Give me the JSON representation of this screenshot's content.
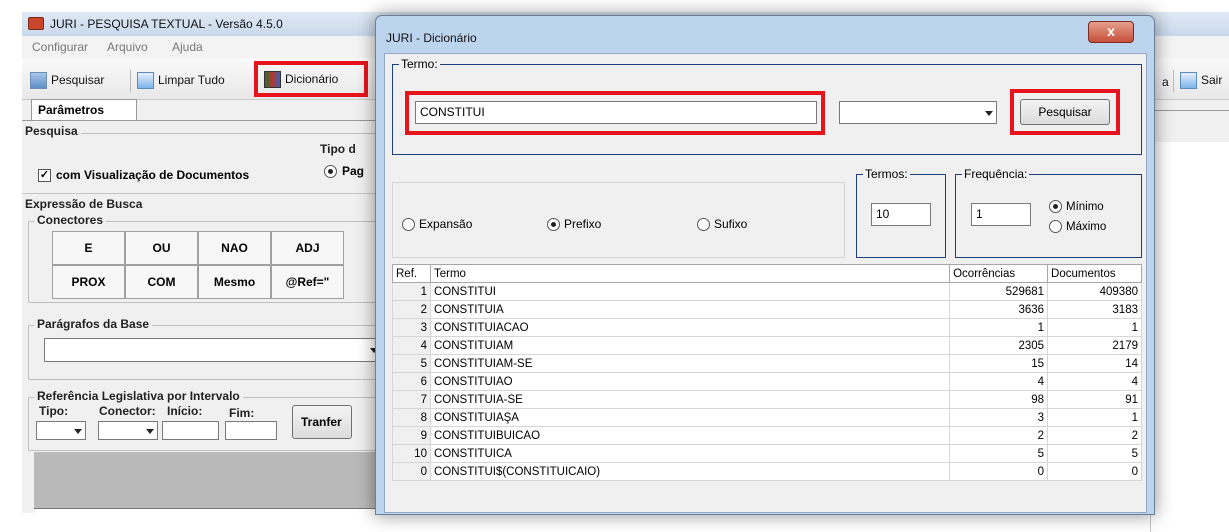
{
  "main_window": {
    "title": "JURI - PESQUISA TEXTUAL - Versão 4.5.0",
    "menu": [
      "Configurar",
      "Arquivo",
      "Ajuda"
    ],
    "toolbar": {
      "pesquisar": "Pesquisar",
      "limpar": "Limpar Tudo",
      "dicionario": "Dicionário",
      "partial_a": "a",
      "sair": "Sair"
    },
    "tab_label": "Parâmetros",
    "pesquisa": {
      "group_label": "Pesquisa",
      "checkbox_label": "com Visualização de Documentos",
      "tipo_label": "Tipo d",
      "tipo_option": "Pag"
    },
    "expressao": {
      "group_label": "Expressão de Busca",
      "conectores_label": "Conectores",
      "connectors_row1": [
        "E",
        "OU",
        "NAO",
        "ADJ"
      ],
      "connectors_row2": [
        "PROX",
        "COM",
        "Mesmo",
        "@Ref=\""
      ]
    },
    "paragrafos_label": "Parágrafos da Base",
    "referencia": {
      "group_label": "Referência Legislativa por Intervalo",
      "tipo": "Tipo:",
      "conector": "Conector:",
      "inicio": "Início:",
      "fim": "Fim:",
      "transfer": "Tranfer"
    }
  },
  "dialog": {
    "title": "JURI - Dicionário",
    "close_glyph": "x",
    "termo_label": "Termo:",
    "termo_value": "CONSTITUI",
    "search_button": "Pesquisar",
    "mode_options": [
      "Expansão",
      "Prefixo",
      "Sufixo"
    ],
    "mode_selected": "Prefixo",
    "termos_label": "Termos:",
    "termos_value": "10",
    "frequencia_label": "Frequência:",
    "frequencia_value": "1",
    "freq_options": [
      "Mínimo",
      "Máximo"
    ],
    "freq_selected": "Mínimo",
    "table": {
      "columns": [
        "Ref.",
        "Termo",
        "Ocorrências",
        "Documentos"
      ],
      "rows": [
        {
          "ref": "1",
          "termo": "CONSTITUI",
          "oc": "529681",
          "doc": "409380"
        },
        {
          "ref": "2",
          "termo": "CONSTITUIA",
          "oc": "3636",
          "doc": "3183"
        },
        {
          "ref": "3",
          "termo": "CONSTITUIACAO",
          "oc": "1",
          "doc": "1"
        },
        {
          "ref": "4",
          "termo": "CONSTITUIAM",
          "oc": "2305",
          "doc": "2179"
        },
        {
          "ref": "5",
          "termo": "CONSTITUIAM-SE",
          "oc": "15",
          "doc": "14"
        },
        {
          "ref": "6",
          "termo": "CONSTITUIAO",
          "oc": "4",
          "doc": "4"
        },
        {
          "ref": "7",
          "termo": "CONSTITUIA-SE",
          "oc": "98",
          "doc": "91"
        },
        {
          "ref": "8",
          "termo": "CONSTITUIAŞA",
          "oc": "3",
          "doc": "1"
        },
        {
          "ref": "9",
          "termo": "CONSTITUIBUICAO",
          "oc": "2",
          "doc": "2"
        },
        {
          "ref": "10",
          "termo": "CONSTITUICA",
          "oc": "5",
          "doc": "5"
        },
        {
          "ref": "0",
          "termo": "CONSTITUI$(CONSTITUICAIO)",
          "oc": "0",
          "doc": "0"
        }
      ]
    }
  },
  "colors": {
    "highlight": "#e8141c",
    "dialog_frame": "#bcd4ed"
  }
}
